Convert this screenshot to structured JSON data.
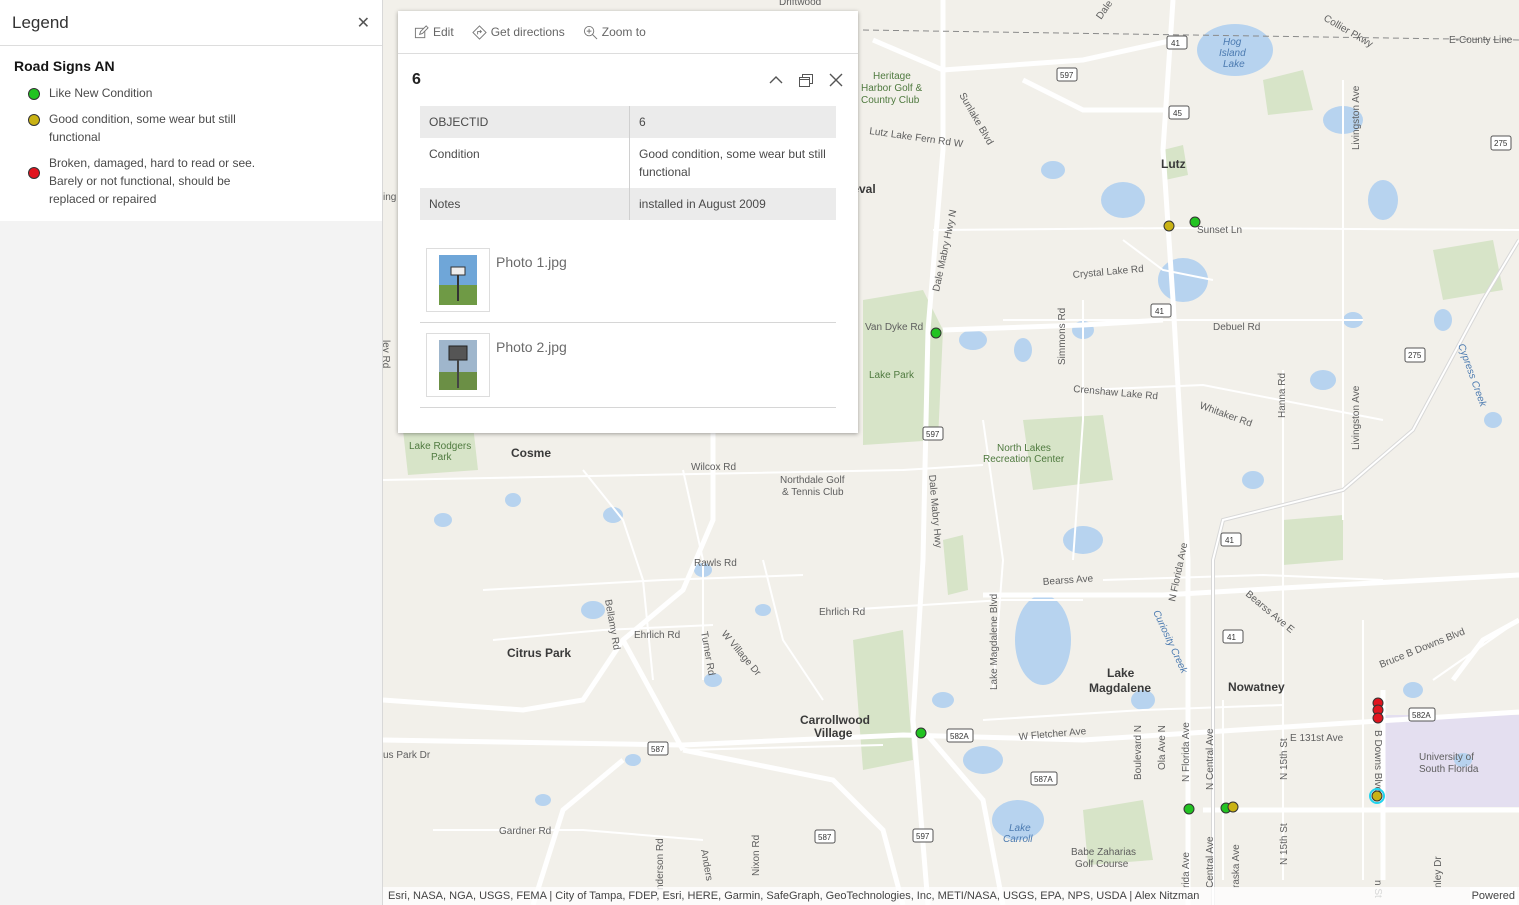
{
  "legend": {
    "title": "Legend",
    "layer_title": "Road Signs AN",
    "items": [
      {
        "label": "Like New Condition",
        "color": "#22c322"
      },
      {
        "label": "Good condition, some wear but still functional",
        "color": "#c9b214"
      },
      {
        "label": "Broken, damaged, hard to read or see. Barely or not functional, should be replaced or repaired",
        "color": "#e0141e"
      }
    ]
  },
  "popup": {
    "toolbar": {
      "edit": "Edit",
      "directions": "Get directions",
      "zoom": "Zoom to"
    },
    "title": "6",
    "attributes": [
      {
        "key": "OBJECTID",
        "value": "6"
      },
      {
        "key": "Condition",
        "value": "Good condition, some wear but still functional"
      },
      {
        "key": "Notes",
        "value": "installed in August 2009"
      }
    ],
    "attachments": [
      {
        "name": "Photo 1.jpg"
      },
      {
        "name": "Photo 2.jpg"
      }
    ]
  },
  "map": {
    "labels": {
      "lutz": "Lutz",
      "cosme": "Cosme",
      "citrus_park": "Citrus Park",
      "lake_magdalene_1": "Lake",
      "lake_magdalene_2": "Magdalene",
      "nowatney": "Nowatney",
      "carrollwood_1": "Carrollwood",
      "carrollwood_2": "Village",
      "usf_1": "University of",
      "usf_2": "South Florida",
      "heritage_1": "Heritage",
      "heritage_2": "Harbor Golf &",
      "heritage_3": "Country Club",
      "lake_park": "Lake Park",
      "lake_rodgers_1": "Lake Rodgers",
      "lake_rodgers_2": "Park",
      "north_lakes_1": "North Lakes",
      "north_lakes_2": "Recreation Center",
      "northdale_1": "Northdale Golf",
      "northdale_2": "& Tennis Club",
      "babe_1": "Babe Zaharias",
      "babe_2": "Golf Course",
      "hog_1": "Hog",
      "hog_2": "Island",
      "hog_3": "Lake",
      "lake_carroll_1": "Lake",
      "lake_carroll_2": "Carroll",
      "cypress_creek": "Cypress Creek",
      "curiosity_creek": "Curiosity Creek",
      "driftwood": "Driftwood",
      "neval": "neval",
      "sunset_ln": "Sunset Ln",
      "crystal_lake": "Crystal Lake Rd",
      "debuel": "Debuel Rd",
      "van_dyke": "Van Dyke Rd",
      "crenshaw": "Crenshaw Lake Rd",
      "whitaker": "Whitaker Rd",
      "wilcox": "Wilcox Rd",
      "rawls": "Rawls Rd",
      "ehrlich": "Ehrlich Rd",
      "ehrlich2": "Ehrlich Rd",
      "bearss": "Bearss Ave",
      "bearss_e": "Bearss Ave E",
      "bruce": "Bruce B Downs Blvd",
      "fletcher": "W Fletcher Ave",
      "e131": "E 131st Ave",
      "gardner": "Gardner Rd",
      "park_dr": "us Park Dr",
      "e_county": "E-County Line",
      "collier": "Collier Pkwy",
      "lutz_lake": "Lutz Lake Fern Rd W",
      "sunlake": "Sunlake Blvd",
      "dale_mabry_n": "Dale Mabry Hwy N",
      "dale_mabry": "Dale Mabry Hwy",
      "simmons": "Simmons Rd",
      "livingston": "Livingston Ave",
      "livingston2": "Livingston Ave",
      "hanna": "Hanna Rd",
      "n_florida": "N Florida Ave",
      "bellamy": "Bellamy Rd",
      "turner": "Turner Rd",
      "w_village": "W Village Dr",
      "lake_mag_blvd": "Lake Magdalene Blvd",
      "boulevard": "Boulevard N",
      "ola": "Ola Ave N",
      "n_florida2": "N Florida Ave",
      "central": "N Central Ave",
      "n15": "N 15th St",
      "n15b": "N 15th St",
      "b_downs": "B Downs Blvd",
      "nixon": "Nixon Rd",
      "anders": "Anders",
      "henderson": "nderson Rd",
      "fl_ave": "rida Ave",
      "central2": "Central Ave",
      "nebraska": "raska Ave",
      "sley": "nley Dr",
      "ley_rd": "ley Rd",
      "cosme_ing": "ing",
      "s_st": "n St",
      "dale_top": "Dale"
    },
    "shields": [
      "41",
      "597",
      "45",
      "41",
      "275",
      "275",
      "597",
      "41",
      "41",
      "582A",
      "582A",
      "587",
      "587A",
      "587",
      "597"
    ],
    "points": [
      {
        "condition": "good",
        "color": "#c9b214"
      },
      {
        "condition": "like-new",
        "color": "#22c322"
      },
      {
        "condition": "like-new",
        "color": "#22c322"
      },
      {
        "condition": "like-new",
        "color": "#22c322"
      },
      {
        "condition": "like-new",
        "color": "#22c322"
      },
      {
        "condition": "like-new",
        "color": "#22c322"
      },
      {
        "condition": "good",
        "color": "#c9b214"
      },
      {
        "condition": "broken",
        "color": "#e0141e"
      },
      {
        "condition": "broken",
        "color": "#e0141e"
      },
      {
        "condition": "broken",
        "color": "#e0141e"
      },
      {
        "condition": "selected",
        "color": "#c9b214"
      }
    ]
  },
  "attribution": "Esri, NASA, NGA, USGS, FEMA | City of Tampa, FDEP, Esri, HERE, Garmin, SafeGraph, GeoTechnologies, Inc, METI/NASA, USGS, EPA, NPS, USDA | Alex Nitzman",
  "powered_by": "Powered"
}
